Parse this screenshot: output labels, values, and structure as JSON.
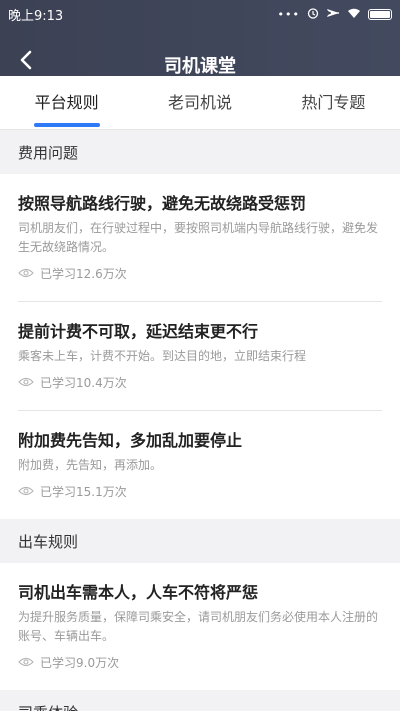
{
  "status": {
    "time": "晚上9:13",
    "dots": "•••"
  },
  "nav": {
    "title": "司机课堂"
  },
  "tabs": [
    {
      "label": "平台规则",
      "active": true
    },
    {
      "label": "老司机说",
      "active": false
    },
    {
      "label": "热门专题",
      "active": false
    }
  ],
  "sections": [
    {
      "title": "费用问题",
      "items": [
        {
          "title": "按照导航路线行驶，避免无故绕路受惩罚",
          "desc": "司机朋友们，在行驶过程中，要按照司机端内导航路线行驶，避免发生无故绕路情况。",
          "views": "已学习12.6万次"
        },
        {
          "title": "提前计费不可取，延迟结束更不行",
          "desc": "乘客未上车，计费不开始。到达目的地，立即结束行程",
          "views": "已学习10.4万次"
        },
        {
          "title": "附加费先告知，多加乱加要停止",
          "desc": "附加费，先告知，再添加。",
          "views": "已学习15.1万次"
        }
      ]
    },
    {
      "title": "出车规则",
      "items": [
        {
          "title": "司机出车需本人，人车不符将严惩",
          "desc": "为提升服务质量，保障司乘安全，请司机朋友们务必使用本人注册的账号、车辆出车。",
          "views": "已学习9.0万次"
        }
      ]
    },
    {
      "title": "司乘体验",
      "items": []
    }
  ],
  "colors": {
    "accent": "#2f7af7",
    "header_bg": "#3c4154"
  }
}
